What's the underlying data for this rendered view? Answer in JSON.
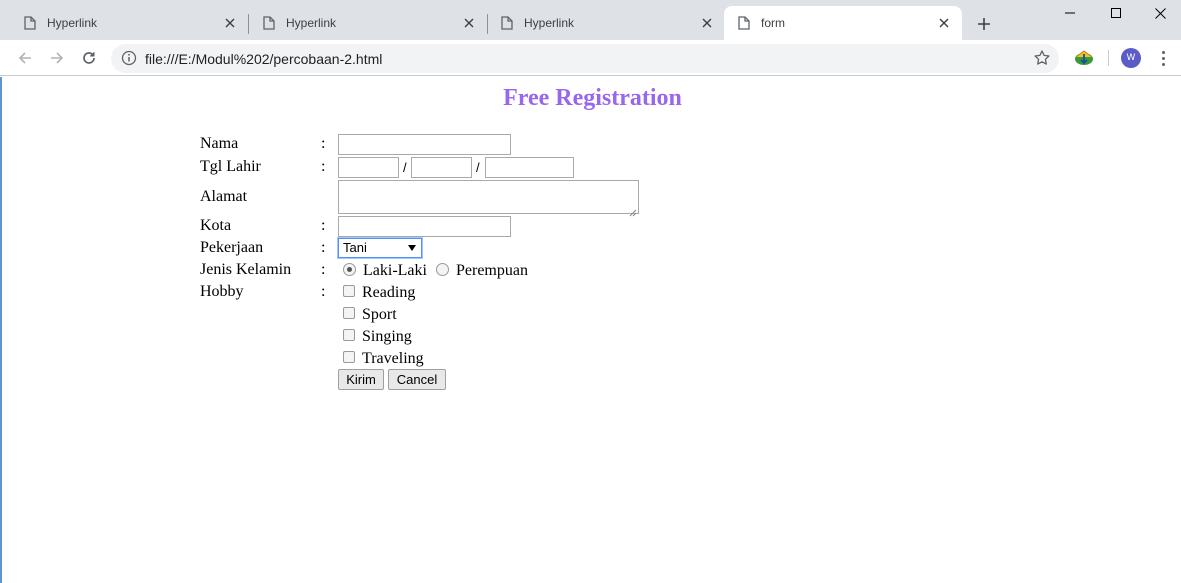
{
  "browser": {
    "tabs": [
      {
        "label": "Hyperlink"
      },
      {
        "label": "Hyperlink"
      },
      {
        "label": "Hyperlink"
      },
      {
        "label": "form"
      }
    ],
    "url": "file:///E:/Modul%202/percobaan-2.html",
    "profile_initial": "W"
  },
  "page": {
    "title": "Free Registration",
    "title_color": "#9966ee",
    "labels": {
      "nama": "Nama",
      "tgl_lahir": "Tgl Lahir",
      "alamat": "Alamat",
      "kota": "Kota",
      "pekerjaan": "Pekerjaan",
      "jenis_kelamin": "Jenis Kelamin",
      "hobby": "Hobby"
    },
    "colon": ":",
    "date_separator": "/",
    "pekerjaan_selected": "Tani",
    "gender_options": [
      {
        "label": "Laki-Laki",
        "checked": true
      },
      {
        "label": "Perempuan",
        "checked": false
      }
    ],
    "hobbies": [
      {
        "label": "Reading",
        "checked": false
      },
      {
        "label": "Sport",
        "checked": false
      },
      {
        "label": "Singing",
        "checked": false
      },
      {
        "label": "Traveling",
        "checked": false
      }
    ],
    "submit_label": "Kirim",
    "cancel_label": "Cancel"
  }
}
